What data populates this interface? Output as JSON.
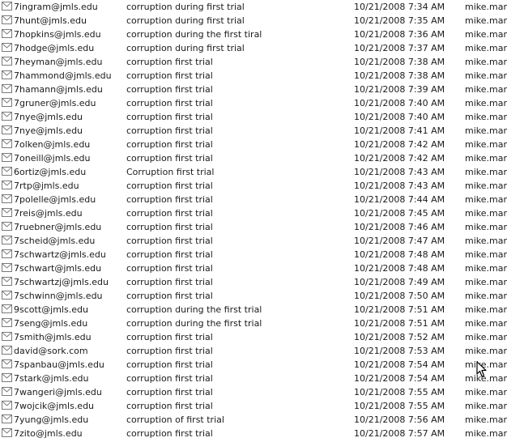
{
  "messages": [
    {
      "from": "7ingram@jmls.edu",
      "subject": "corruption during first trial",
      "received": "10/21/2008 7:34 AM",
      "to": "mike.mars"
    },
    {
      "from": "7hunt@jmls.edu",
      "subject": "corruption during first trial",
      "received": "10/21/2008 7:35 AM",
      "to": "mike.mars"
    },
    {
      "from": "7hopkins@jmls.edu",
      "subject": "corruption during the first tiral",
      "received": "10/21/2008 7:36 AM",
      "to": "mike.mars"
    },
    {
      "from": "7hodge@jmls.edu",
      "subject": "corruption during first trial",
      "received": "10/21/2008 7:37 AM",
      "to": "mike.mars"
    },
    {
      "from": "7heyman@jmls.edu",
      "subject": "corruption first trial",
      "received": "10/21/2008 7:38 AM",
      "to": "mike.mars"
    },
    {
      "from": "7hammond@jmls.edu",
      "subject": "corruption first trial",
      "received": "10/21/2008 7:38 AM",
      "to": "mike.mars"
    },
    {
      "from": "7hamann@jmls.edu",
      "subject": "corruption first trial",
      "received": "10/21/2008 7:39 AM",
      "to": "mike.mars"
    },
    {
      "from": "7gruner@jmls.edu",
      "subject": "corruption first trial",
      "received": "10/21/2008 7:40 AM",
      "to": "mike.mars"
    },
    {
      "from": "7nye@jmls.edu",
      "subject": "corruption first trial",
      "received": "10/21/2008 7:40 AM",
      "to": "mike.mars"
    },
    {
      "from": "7nye@jmls.edu",
      "subject": "corruption first trial",
      "received": "10/21/2008 7:41 AM",
      "to": "mike.mars"
    },
    {
      "from": "7olken@jmls.edu",
      "subject": "corruption first trial",
      "received": "10/21/2008 7:42 AM",
      "to": "mike.mars"
    },
    {
      "from": "7oneill@jmls.edu",
      "subject": "corruption first trial",
      "received": "10/21/2008 7:42 AM",
      "to": "mike.mars"
    },
    {
      "from": "6ortiz@jmls.edu",
      "subject": "Corruption first trial",
      "received": "10/21/2008 7:43 AM",
      "to": "mike.mars"
    },
    {
      "from": "7rtp@jmls.edu",
      "subject": "corruption first trial",
      "received": "10/21/2008 7:43 AM",
      "to": "mike.mars"
    },
    {
      "from": "7polelle@jmls.edu",
      "subject": "corruption first trial",
      "received": "10/21/2008 7:44 AM",
      "to": "mike.mars"
    },
    {
      "from": "7reis@jmls.edu",
      "subject": "corruption first trial",
      "received": "10/21/2008 7:45 AM",
      "to": "mike.mars"
    },
    {
      "from": "7ruebner@jmls.edu",
      "subject": "corruption first trial",
      "received": "10/21/2008 7:46 AM",
      "to": "mike.mars"
    },
    {
      "from": "7scheid@jmls.edu",
      "subject": "corruption first trial",
      "received": "10/21/2008 7:47 AM",
      "to": "mike.mars"
    },
    {
      "from": "7schwartz@jmls.edu",
      "subject": "corruption first trial",
      "received": "10/21/2008 7:48 AM",
      "to": "mike.mars"
    },
    {
      "from": "7schwart@jmls.edu",
      "subject": "corruption first trial",
      "received": "10/21/2008 7:48 AM",
      "to": "mike.mars"
    },
    {
      "from": "7schwartzj@jmls.edu",
      "subject": "corruption first trial",
      "received": "10/21/2008 7:49 AM",
      "to": "mike.mars"
    },
    {
      "from": "7schwinn@jmls.edu",
      "subject": "corruption first trial",
      "received": "10/21/2008 7:50 AM",
      "to": "mike.mars"
    },
    {
      "from": "9scott@jmls.edu",
      "subject": "corruption during the first trial",
      "received": "10/21/2008 7:51 AM",
      "to": "mike.mars"
    },
    {
      "from": "7seng@jmls.edu",
      "subject": "corruption during the first trial",
      "received": "10/21/2008 7:51 AM",
      "to": "mike.mars"
    },
    {
      "from": "7smith@jmls.edu",
      "subject": "corruption first trial",
      "received": "10/21/2008 7:52 AM",
      "to": "mike.mars"
    },
    {
      "from": "david@sork.com",
      "subject": "corruption first trial",
      "received": "10/21/2008 7:53 AM",
      "to": "mike.mars"
    },
    {
      "from": "7spanbau@jmls.edu",
      "subject": "corruption first trial",
      "received": "10/21/2008 7:54 AM",
      "to": "mike.mars"
    },
    {
      "from": "7stark@jmls.edu",
      "subject": "corruption first trial",
      "received": "10/21/2008 7:54 AM",
      "to": "mike.mars"
    },
    {
      "from": "7wangeri@jmls.edu",
      "subject": "corruption first trial",
      "received": "10/21/2008 7:55 AM",
      "to": "mike.mars"
    },
    {
      "from": "7wojcik@jmls.edu",
      "subject": "corruption first trial",
      "received": "10/21/2008 7:55 AM",
      "to": "mike.mars"
    },
    {
      "from": "7yung@jmls.edu",
      "subject": "corruption of first trial",
      "received": "10/21/2008 7:56 AM",
      "to": "mike.mars"
    },
    {
      "from": "7zito@jmls.edu",
      "subject": "corruption first trial",
      "received": "10/21/2008 7:57 AM",
      "to": "mike.mars"
    }
  ],
  "icons": {
    "row_icon": "envelope-icon",
    "pointer": "mouse-pointer-icon"
  },
  "colors": {
    "text": "#1a1a1a",
    "envelope_stroke": "#7a7a7a"
  }
}
